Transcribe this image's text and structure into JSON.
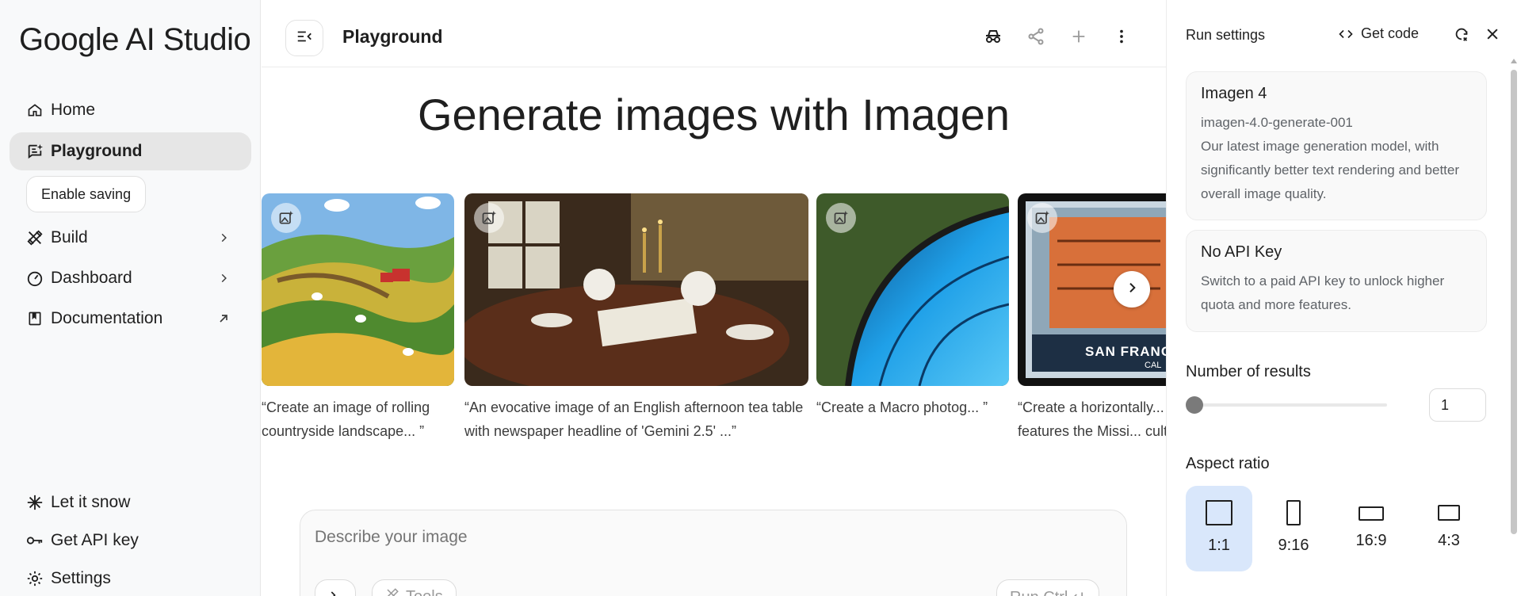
{
  "app": {
    "logo": "Google AI Studio"
  },
  "sidebar": {
    "items": [
      {
        "label": "Home",
        "icon": "home-icon"
      },
      {
        "label": "Playground",
        "icon": "playground-icon"
      },
      {
        "label": "Build",
        "icon": "build-icon"
      },
      {
        "label": "Dashboard",
        "icon": "dashboard-icon"
      },
      {
        "label": "Documentation",
        "icon": "documentation-icon"
      }
    ],
    "enable_saving": "Enable saving",
    "bottom": [
      {
        "label": "Let it snow",
        "icon": "snowflake-icon"
      },
      {
        "label": "Get API key",
        "icon": "key-icon"
      },
      {
        "label": "Settings",
        "icon": "gear-icon"
      }
    ]
  },
  "main": {
    "title": "Playground",
    "headline": "Generate images with Imagen",
    "gallery": [
      {
        "caption": "“Create an image of rolling countryside landscape... ”"
      },
      {
        "caption": "“An evocative image of an English afternoon tea table with newspaper headline of 'Gemini 2.5' ...”"
      },
      {
        "caption": "“Create a Macro photog... ”"
      },
      {
        "caption": "“Create a horizontally... that features the Missi... culture...”",
        "stamp_text": "SAN FRANCI",
        "stamp_sub": "CAL"
      }
    ],
    "composer": {
      "placeholder": "Describe your image",
      "tools_label": "Tools",
      "run_label": "Run Ctrl ↵"
    }
  },
  "panel": {
    "title": "Run settings",
    "get_code": "Get code",
    "model": {
      "name": "Imagen 4",
      "id": "imagen-4.0-generate-001",
      "description": "Our latest image generation model, with significantly better text rendering and better overall image quality."
    },
    "api": {
      "title": "No API Key",
      "description": "Switch to a paid API key to unlock higher quota and more features."
    },
    "results": {
      "label": "Number of results",
      "value": "1",
      "slider_fraction": 0.0
    },
    "aspect": {
      "label": "Aspect ratio",
      "options": [
        "1:1",
        "9:16",
        "16:9",
        "4:3"
      ],
      "selected": "1:1"
    }
  },
  "colors": {
    "accent": "#d9e7fb",
    "sidebar_bg": "#f8f9fa",
    "active_nav": "#e6e6e6"
  }
}
